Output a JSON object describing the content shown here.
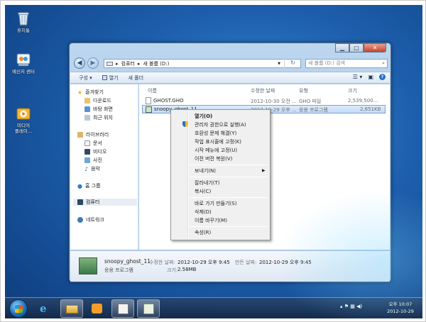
{
  "desktop": {
    "icons": [
      {
        "label": "휴지통"
      },
      {
        "label": "메신저 센터"
      },
      {
        "label": "미디어\n플레이..."
      }
    ]
  },
  "window": {
    "address": {
      "path_root": "컴퓨터",
      "sep": "▸",
      "path_drive": "새 볼륨 (D:)",
      "search_placeholder": "새 볼륨 (D:) 검색"
    },
    "toolbar": {
      "organize": "구성 ▾",
      "open": "열기",
      "new_folder": "새 폴더"
    },
    "nav": {
      "favorites": "즐겨찾기",
      "downloads": "다운로드",
      "desktop": "바탕 화면",
      "recent": "최근 위치",
      "libraries": "라이브러리",
      "documents": "문서",
      "videos": "비디오",
      "pictures": "사진",
      "music": "음악",
      "homegroup": "홈 그룹",
      "computer": "컴퓨터",
      "network": "네트워크"
    },
    "columns": {
      "name": "이름",
      "modified": "수정한 날짜",
      "type": "유형",
      "size": "크기"
    },
    "files": [
      {
        "name": "GHOST.GHO",
        "modified": "2012-10-30 오전 ...",
        "type": "GHO 파일",
        "size": "2,539,500..."
      },
      {
        "name": "snoopy_ghost_11",
        "modified": "2012-10-29 오후 ...",
        "type": "응용 프로그램",
        "size": "2,651KB"
      }
    ],
    "status": {
      "name": "snoopy_ghost_11",
      "type": "응용 프로그램",
      "modified_label": "수정한 날짜:",
      "modified": "2012-10-29 오후 9:45",
      "created_label": "만든 날짜:",
      "created": "2012-10-29 오후 9:45",
      "size_label": "크기:",
      "size": "2.58MB"
    }
  },
  "context_menu": {
    "items": [
      {
        "label": "열기(O)"
      },
      {
        "label": "관리자 권한으로 실행(A)"
      },
      {
        "label": "호환성 문제 해결(Y)"
      },
      {
        "label": "작업 표시줄에 고정(K)"
      },
      {
        "label": "시작 메뉴에 고정(U)"
      },
      {
        "label": "이전 버전 복원(V)"
      },
      {
        "label": "보내기(N)"
      },
      {
        "label": "잘라내기(T)"
      },
      {
        "label": "복사(C)"
      },
      {
        "label": "바로 가기 만들기(S)"
      },
      {
        "label": "삭제(D)"
      },
      {
        "label": "이름 바꾸기(M)"
      },
      {
        "label": "속성(R)"
      }
    ]
  },
  "taskbar": {
    "clock_time": "오후 10:07",
    "clock_date": "2012-10-29"
  },
  "colors": {
    "selection": "#c3dcf8",
    "menu_bg": "#f0f0f0"
  }
}
